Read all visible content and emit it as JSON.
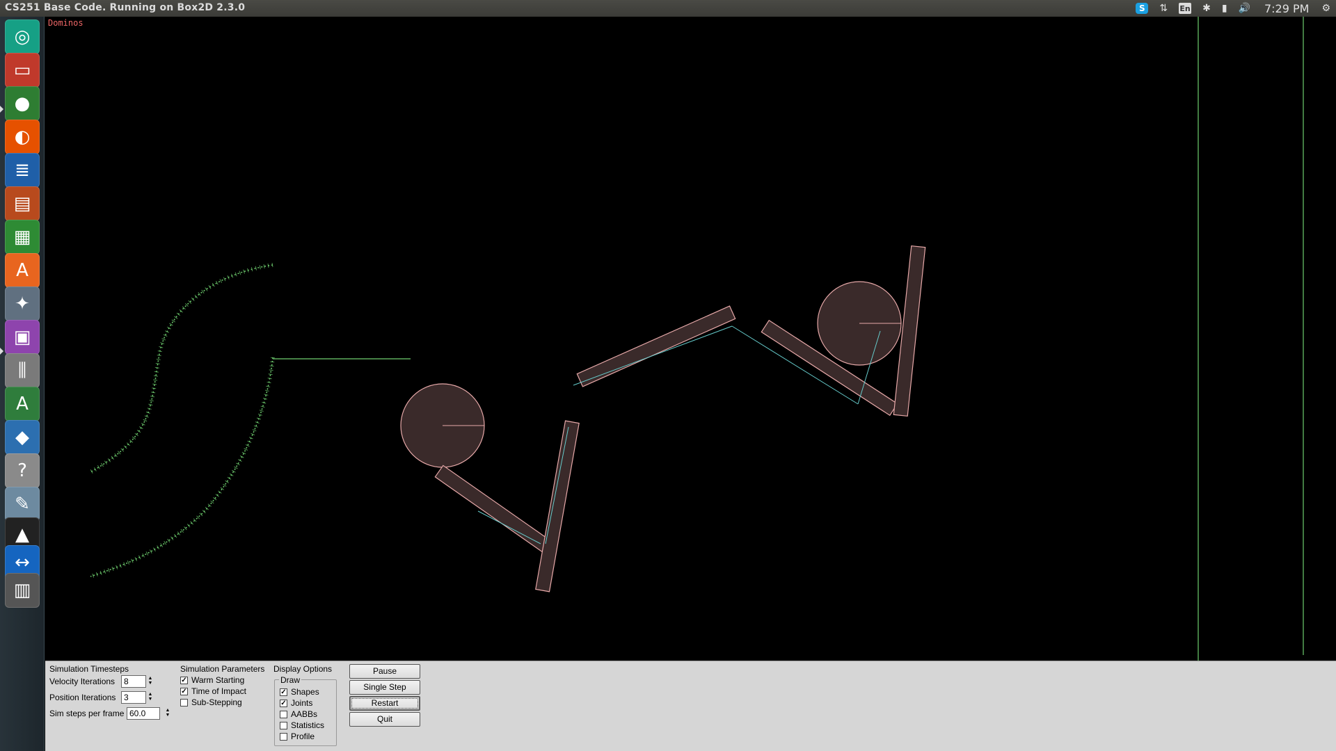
{
  "window": {
    "title": "CS251 Base Code. Running on Box2D 2.3.0"
  },
  "indicators": {
    "skype": "S",
    "network": "⇅",
    "language": "En",
    "bluetooth": "✱",
    "battery": "▮",
    "volume": "🔊",
    "time": "7:29 PM",
    "settings": "⚙"
  },
  "launcher": [
    {
      "name": "ubuntu-dash-icon",
      "glyph": "◎",
      "color": "#16a085"
    },
    {
      "name": "files-icon",
      "glyph": "▭",
      "color": "#c0392b"
    },
    {
      "name": "chrome-icon",
      "glyph": "●",
      "color": "#2e7d32"
    },
    {
      "name": "firefox-icon",
      "glyph": "◐",
      "color": "#e65100"
    },
    {
      "name": "writer-icon",
      "glyph": "≣",
      "color": "#1f5fa8"
    },
    {
      "name": "impress-icon",
      "glyph": "▤",
      "color": "#b84a1d"
    },
    {
      "name": "calc-icon",
      "glyph": "▦",
      "color": "#2e8b34"
    },
    {
      "name": "software-center-icon",
      "glyph": "A",
      "color": "#e8651f"
    },
    {
      "name": "system-settings-icon",
      "glyph": "✦",
      "color": "#607080"
    },
    {
      "name": "workspace-switcher-icon",
      "glyph": "▣",
      "color": "#8e44ad"
    },
    {
      "name": "mixer-icon",
      "glyph": "⫼",
      "color": "#7a7a7a"
    },
    {
      "name": "android-studio-icon",
      "glyph": "A",
      "color": "#2f7d3c"
    },
    {
      "name": "python-icon",
      "glyph": "◆",
      "color": "#2c6fb0"
    },
    {
      "name": "help-icon",
      "glyph": "?",
      "color": "#8a8a8a"
    },
    {
      "name": "image-viewer-icon",
      "glyph": "✎",
      "color": "#6d8aa0"
    },
    {
      "name": "inkscape-icon",
      "glyph": "▲",
      "color": "#222222"
    },
    {
      "name": "teamviewer-icon",
      "glyph": "↔",
      "color": "#1565c0"
    },
    {
      "name": "trash-icon",
      "glyph": "▥",
      "color": "#555555"
    }
  ],
  "simulation": {
    "label": "Dominos"
  },
  "panel": {
    "timesteps": {
      "title": "Simulation Timesteps",
      "velocity_label": "Velocity Iterations",
      "velocity_value": "8",
      "position_label": "Position Iterations",
      "position_value": "3",
      "steps_label": "Sim steps per frame",
      "steps_value": "60.0"
    },
    "parameters": {
      "title": "Simulation Parameters",
      "items": [
        {
          "label": "Warm Starting",
          "checked": true
        },
        {
          "label": "Time of Impact",
          "checked": true
        },
        {
          "label": "Sub-Stepping",
          "checked": false
        }
      ]
    },
    "display": {
      "title": "Display Options",
      "group": "Draw",
      "items": [
        {
          "label": "Shapes",
          "checked": true
        },
        {
          "label": "Joints",
          "checked": true
        },
        {
          "label": "AABBs",
          "checked": false
        },
        {
          "label": "Statistics",
          "checked": false
        },
        {
          "label": "Profile",
          "checked": false
        }
      ]
    },
    "buttons": {
      "pause": "Pause",
      "single_step": "Single Step",
      "restart": "Restart",
      "quit": "Quit"
    }
  },
  "colors": {
    "ground": "#6fcf6f",
    "body_fill": "#3a2a2a",
    "body_stroke": "#e6a8a8",
    "joint": "#66cccc"
  }
}
